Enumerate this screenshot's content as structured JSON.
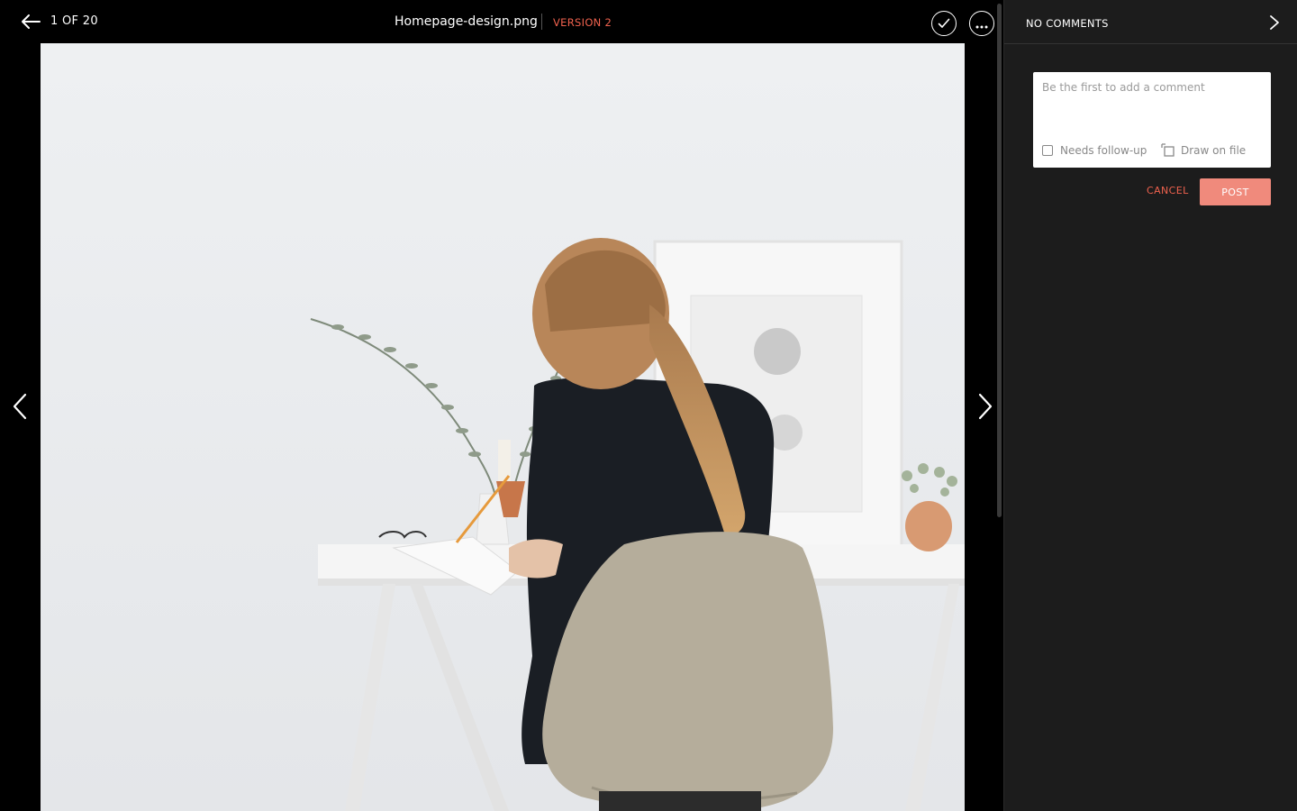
{
  "viewer": {
    "counter": "1 OF 20",
    "file_name": "Homepage-design.png",
    "version": "VERSION 2"
  },
  "comments": {
    "header": "NO COMMENTS",
    "placeholder": "Be the first to add a comment",
    "followup_label": "Needs follow-up",
    "draw_label": "Draw on file",
    "cancel_label": "CANCEL",
    "post_label": "POST"
  },
  "icons": {
    "back": "arrow-left-icon",
    "approve": "check-circle-icon",
    "more": "ellipsis-circle-icon",
    "prev": "chevron-left-icon",
    "next": "chevron-right-icon",
    "collapse": "chevron-right-icon",
    "draw": "draw-on-file-icon"
  },
  "colors": {
    "accent": "#f0624e",
    "post_button": "#f08a7c",
    "panel_bg": "#1c1c1c"
  }
}
